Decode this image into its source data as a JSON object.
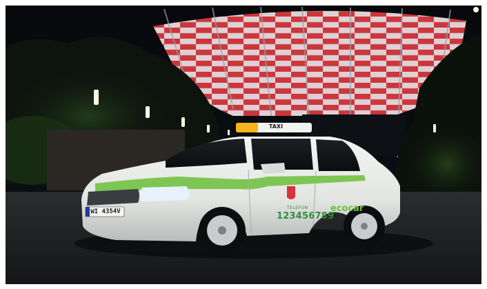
{
  "scene": {
    "roof_sign_text": "TAXI",
    "phone_label": "TELEFON",
    "phone_number": "123456789",
    "brand_name": "ecocar",
    "license_plate": "WI 4354V"
  },
  "colors": {
    "night_sky": "#07090c",
    "stadium_red": "#d8323a",
    "stadium_white": "#eef0f4",
    "car_body": "#e9ebe8",
    "brand_green": "#6bbf3a",
    "text_green": "#2f8f3a",
    "roof_sign_amber": "#f6b21f"
  }
}
